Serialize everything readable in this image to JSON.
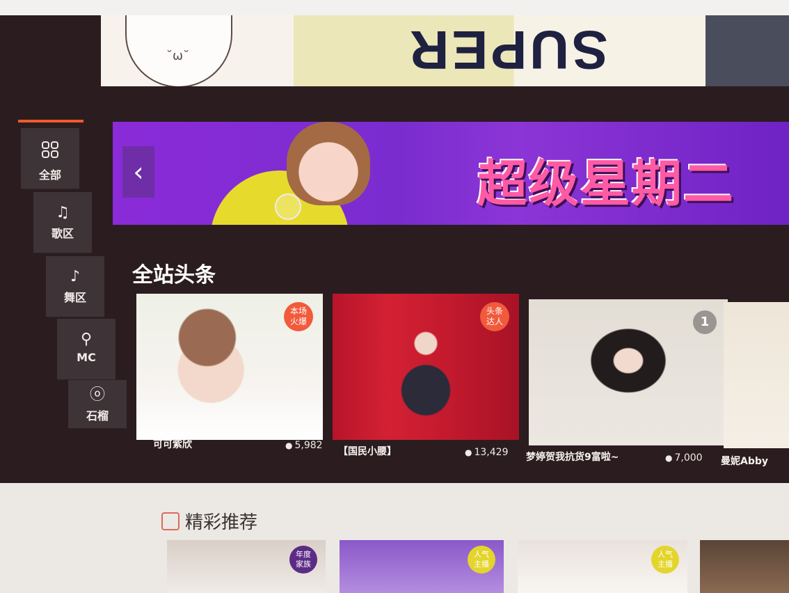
{
  "sidebar": {
    "items": [
      {
        "label": "全部",
        "icon": "grid-icon"
      },
      {
        "label": "歌区",
        "icon": "music-note-icon"
      },
      {
        "label": "舞区",
        "icon": "dancer-icon"
      },
      {
        "label": "MC",
        "icon": "microphone-icon"
      },
      {
        "label": "石榴",
        "icon": "pomegranate-icon"
      }
    ]
  },
  "banner": {
    "title": "超级星期二",
    "prev_symbol": "‹"
  },
  "top_strip": {
    "text": "SUPER"
  },
  "headlines": {
    "title": "全站头条",
    "cards": [
      {
        "name": "可可紫欣",
        "viewers": "5,982",
        "badge": "本场\n火爆"
      },
      {
        "name": "【国民小腰】",
        "viewers": "13,429",
        "badge": "头条\n达人"
      },
      {
        "name": "梦婷贺我抗货9富啦~",
        "viewers": "7,000",
        "badge": "1"
      },
      {
        "name": "曼妮Abby",
        "viewers": "",
        "badge": ""
      }
    ]
  },
  "recommend": {
    "title": "精彩推荐",
    "badges": [
      "年度\n家族",
      "人气\n主播",
      "人气\n主播"
    ]
  },
  "colors": {
    "accent": "#f05a2a",
    "badge_red": "#f15a3b",
    "banner_purple": "#8b2bd9",
    "dark_bg": "#2b1d1f"
  }
}
